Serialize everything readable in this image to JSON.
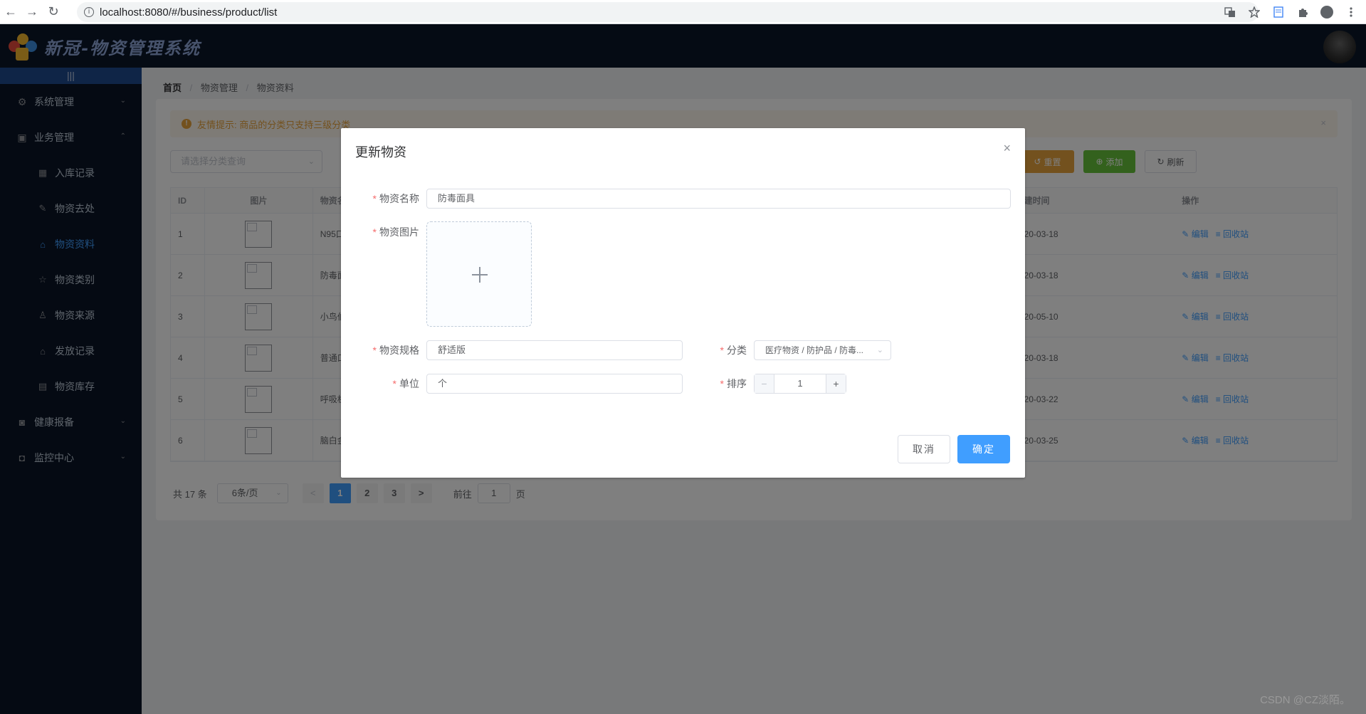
{
  "browser": {
    "url": "localhost:8080/#/business/product/list",
    "back_icon": "←",
    "forward_icon": "→",
    "reload_icon": "↻",
    "info_icon": "i"
  },
  "header": {
    "app_title": "新冠-物资管理系统"
  },
  "sidebar": {
    "collapse_icon": "|||",
    "items": [
      {
        "label": "系统管理",
        "icon": "gear-icon",
        "glyph": "⚙",
        "arrow": "⌄"
      },
      {
        "label": "业务管理",
        "icon": "briefcase-icon",
        "glyph": "▣",
        "arrow": "⌃"
      },
      {
        "label": "健康报备",
        "icon": "health-icon",
        "glyph": "◙",
        "arrow": "⌄"
      },
      {
        "label": "监控中心",
        "icon": "camera-icon",
        "glyph": "◘",
        "arrow": "⌄"
      }
    ],
    "sub_items": [
      {
        "label": "入库记录",
        "icon": "calendar-icon",
        "glyph": "▦"
      },
      {
        "label": "物资去处",
        "icon": "edit-icon",
        "glyph": "✎"
      },
      {
        "label": "物资资料",
        "icon": "bag-icon",
        "glyph": "⌂"
      },
      {
        "label": "物资类别",
        "icon": "star-icon",
        "glyph": "☆"
      },
      {
        "label": "物资来源",
        "icon": "user-icon",
        "glyph": "♙"
      },
      {
        "label": "发放记录",
        "icon": "bag-icon",
        "glyph": "⌂"
      },
      {
        "label": "物资库存",
        "icon": "document-icon",
        "glyph": "▤"
      }
    ]
  },
  "breadcrumb": {
    "home": "首页",
    "sep": "/",
    "level1": "物资管理",
    "level2": "物资资料"
  },
  "alert": {
    "text": "友情提示: 商品的分类只支持三级分类",
    "icon": "!",
    "close": "×"
  },
  "toolbar": {
    "category_placeholder": "请选择分类查询",
    "chevron": "⌄",
    "reset": "重置",
    "reset_icon": "↺",
    "add": "添加",
    "add_icon": "⊕",
    "refresh": "刷新",
    "refresh_icon": "↻"
  },
  "table": {
    "headers": {
      "id": "ID",
      "image": "图片",
      "name": "物资名",
      "time": "建时间",
      "op": "操作"
    },
    "edit_label": "编辑",
    "edit_icon": "✎",
    "recycle_label": "回收站",
    "recycle_icon": "≡",
    "rows": [
      {
        "id": "1",
        "name": "N95口",
        "time": "20-03-18"
      },
      {
        "id": "2",
        "name": "防毒面",
        "time": "20-03-18"
      },
      {
        "id": "3",
        "name": "小鸟伯",
        "time": "20-05-10"
      },
      {
        "id": "4",
        "name": "普通口",
        "time": "20-03-18"
      },
      {
        "id": "5",
        "name": "呼吸机",
        "time": "20-03-22"
      },
      {
        "id": "6",
        "name": "脑白金",
        "time": "20-03-25"
      }
    ]
  },
  "pagination": {
    "total": "共 17 条",
    "page_size": "6条/页",
    "chevron": "⌄",
    "prev": "<",
    "next": ">",
    "pages": [
      "1",
      "2",
      "3"
    ],
    "goto_label": "前往",
    "goto_value": "1",
    "goto_suffix": "页"
  },
  "dialog": {
    "title": "更新物资",
    "close": "×",
    "required_mark": "*",
    "name_label": "物资名称",
    "name_value": "防毒面具",
    "image_label": "物资图片",
    "spec_label": "物资规格",
    "spec_value": "舒适版",
    "category_label": "分类",
    "category_value": "医疗物资 / 防护品 / 防毒...",
    "unit_label": "单位",
    "unit_value": "个",
    "sort_label": "排序",
    "sort_value": "1",
    "minus": "−",
    "plus": "+",
    "cancel": "取消",
    "confirm": "确定"
  },
  "watermark": "CSDN @CZ淡陌。",
  "colors": {
    "primary": "#409eff",
    "warning": "#e6a23c",
    "success": "#67c23a",
    "sidebar_bg": "#0b1526",
    "header_bg": "#0a1628"
  }
}
